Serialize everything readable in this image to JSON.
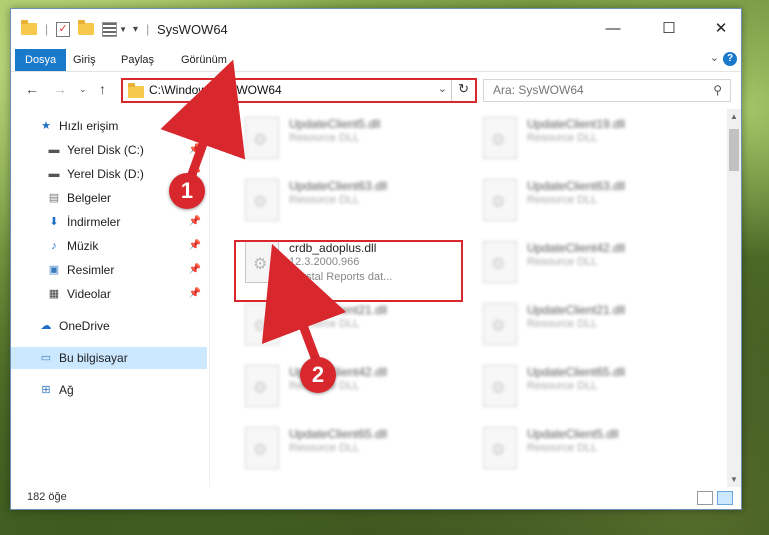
{
  "window": {
    "title": "SysWOW64"
  },
  "ribbon": {
    "tabs": [
      "Dosya",
      "Giriş",
      "Paylaş",
      "Görünüm"
    ]
  },
  "nav": {
    "address": "C:\\Windows\\SysWOW64",
    "search_placeholder": "Ara: SysWOW64"
  },
  "sidebar": {
    "items": [
      {
        "label": "Hızlı erişim"
      },
      {
        "label": "Yerel Disk (C:)"
      },
      {
        "label": "Yerel Disk (D:)"
      },
      {
        "label": "Belgeler"
      },
      {
        "label": "İndirmeler"
      },
      {
        "label": "Müzik"
      },
      {
        "label": "Resimler"
      },
      {
        "label": "Videolar"
      },
      {
        "label": "OneDrive"
      },
      {
        "label": "Bu bilgisayar"
      },
      {
        "label": "Ağ"
      }
    ]
  },
  "files": {
    "left": [
      {
        "name": "UpdateClient5.dll",
        "sub": "Resource DLL"
      },
      {
        "name": "UpdateClient63.dll",
        "sub": "Resource DLL"
      },
      {
        "name": "crdb_adoplus.dll",
        "version": "12.3.2000.966",
        "desc": "Crystal Reports dat..."
      },
      {
        "name": "UpdateClient21.dll",
        "sub": "Resource DLL"
      },
      {
        "name": "UpdateClient42.dll",
        "sub": "Resource DLL"
      },
      {
        "name": "UpdateClient65.dll",
        "sub": "Resource DLL"
      }
    ],
    "right": [
      {
        "name": "UpdateClient19.dll",
        "sub": "Resource DLL"
      },
      {
        "name": "UpdateClient63.dll",
        "sub": "Resource DLL"
      },
      {
        "name": "UpdateClient42.dll",
        "sub": "Resource DLL"
      },
      {
        "name": "UpdateClient21.dll",
        "sub": "Resource DLL"
      },
      {
        "name": "UpdateClient65.dll",
        "sub": "Resource DLL"
      },
      {
        "name": "UpdateClient5.dll",
        "sub": "Resource DLL"
      }
    ]
  },
  "status": {
    "count": "182 öğe"
  },
  "callouts": [
    "1",
    "2"
  ],
  "colors": {
    "accent": "#1979ca",
    "annotation": "#d9272e",
    "selection": "#cce8ff"
  }
}
